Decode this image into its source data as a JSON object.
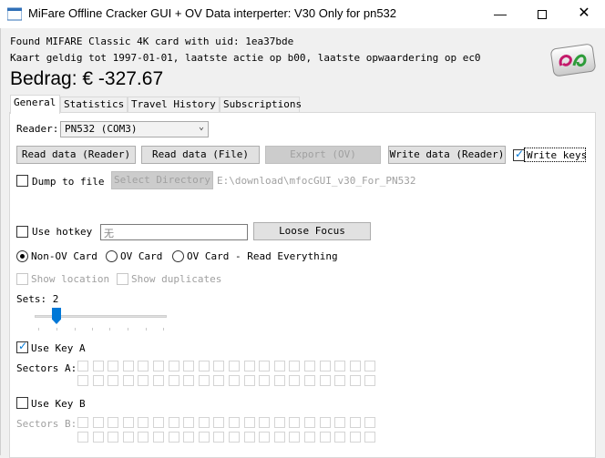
{
  "window": {
    "title": "MiFare Offline Cracker GUI + OV Data interperter: V30 Only for pn532",
    "minimize_glyph": "—",
    "close_glyph": "✕"
  },
  "card_info": {
    "found_line": "Found MIFARE Classic 4K card with uid: 1ea37bde",
    "valid_line": "Kaart geldig tot 1997-01-01, laatste actie op b00, laatste opwaardering op ec0",
    "balance": "Bedrag: € -327.67"
  },
  "tabs": [
    "General",
    "Statistics",
    "Travel History",
    "Subscriptions"
  ],
  "general": {
    "reader_label": "Reader:",
    "reader_value": "PN532 (COM3)",
    "buttons": {
      "read_reader": "Read data (Reader)",
      "read_file": "Read data (File)",
      "export_ov": "Export (OV)",
      "write_reader": "Write data (Reader)"
    },
    "write_keys_label": "Write keys",
    "write_keys_checked": true,
    "dump_to_file_label": "Dump to file",
    "dump_to_file_checked": false,
    "select_directory_label": "Select Directory",
    "directory_path": "E:\\download\\mfocGUI_v30_For_PN532",
    "use_hotkey_label": "Use hotkey",
    "use_hotkey_checked": false,
    "hotkey_value": "无",
    "loose_focus_label": "Loose Focus",
    "card_modes": [
      "Non-OV Card",
      "OV Card",
      "OV Card - Read Everything"
    ],
    "selected_card_mode": "Non-OV Card",
    "show_location_label": "Show location",
    "show_duplicates_label": "Show duplicates",
    "sets_label": "Sets: 2",
    "sets_value": 2,
    "use_key_a_label": "Use Key A",
    "use_key_a_checked": true,
    "sectors_a_label": "Sectors A:",
    "use_key_b_label": "Use Key B",
    "use_key_b_checked": false,
    "sectors_b_label": "Sectors B:"
  },
  "colors": {
    "accent": "#0078d7",
    "panel_bg": "#ffffff",
    "window_bg": "#f0f0f0",
    "disabled_text": "#a0a0a0"
  }
}
